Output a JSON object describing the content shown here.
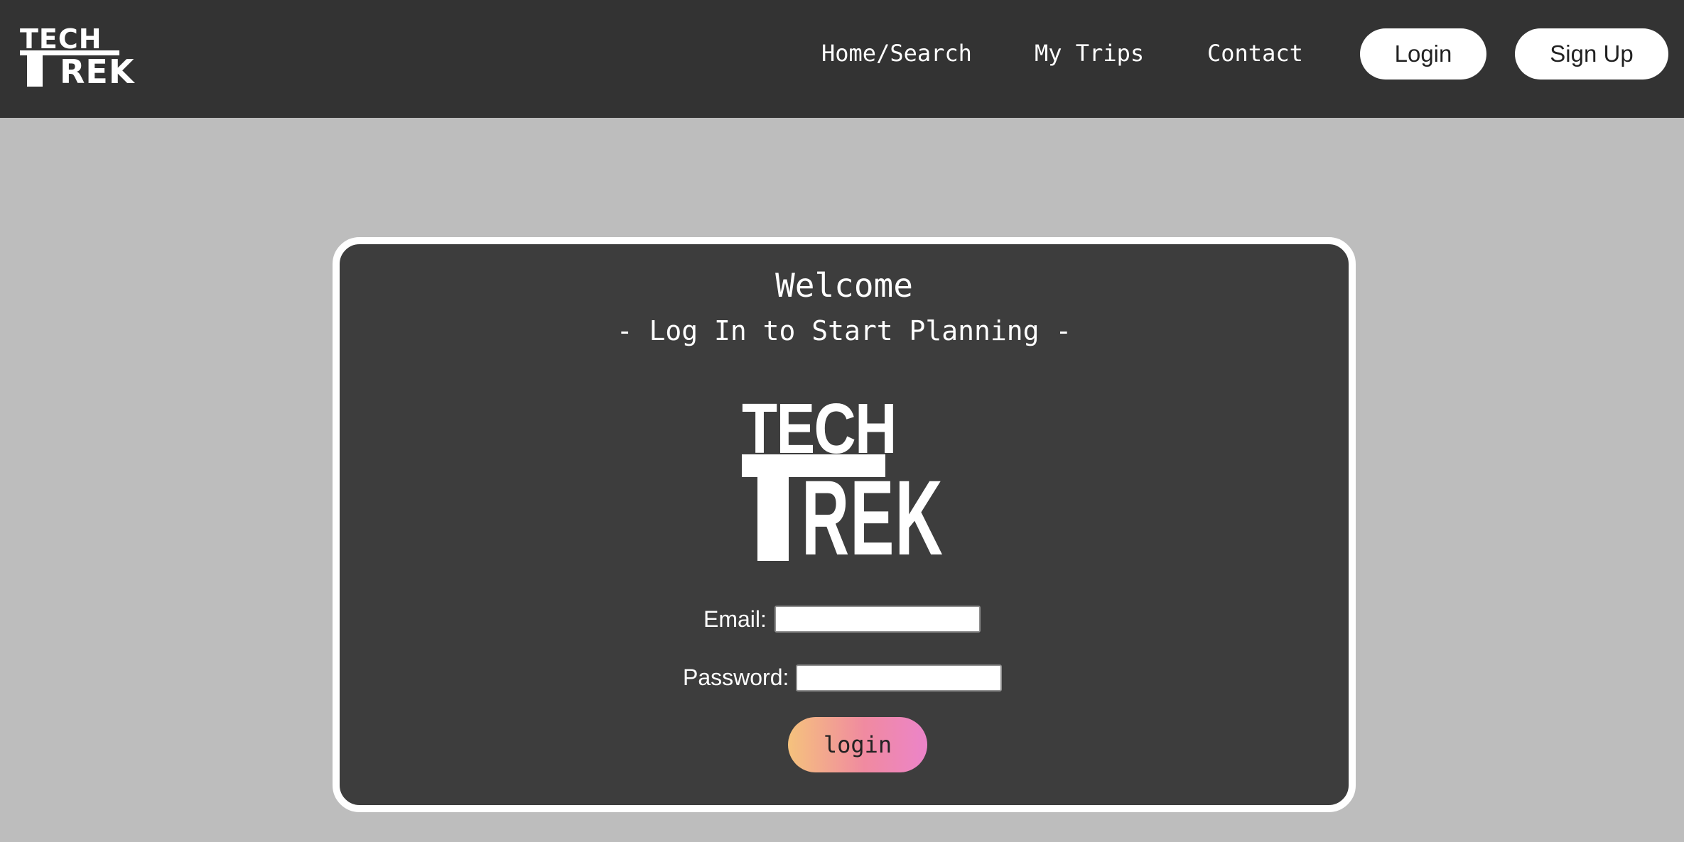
{
  "header": {
    "logo": {
      "line1": "TECH",
      "line2": "REK"
    },
    "nav": [
      {
        "label": "Home/Search"
      },
      {
        "label": "My Trips"
      },
      {
        "label": "Contact"
      }
    ],
    "login_label": "Login",
    "signup_label": "Sign Up"
  },
  "card": {
    "title": "Welcome",
    "subtitle": "- Log In to Start Planning -",
    "logo": {
      "line1": "TECH",
      "line2": "REK"
    },
    "email_label": "Email:",
    "email_value": "",
    "password_label": "Password:",
    "password_value": "",
    "submit_label": "login"
  },
  "colors": {
    "page_background": "#bdbdbd",
    "header_background": "#333333",
    "card_background": "#3d3d3d",
    "submit_gradient_start": "#f5c27d",
    "submit_gradient_end": "#ec84c9"
  }
}
